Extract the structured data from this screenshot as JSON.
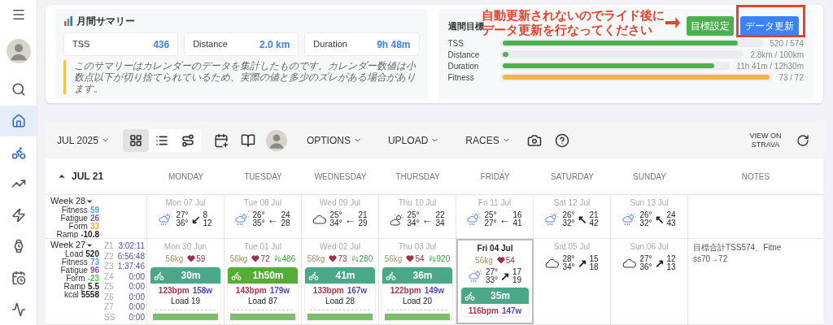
{
  "sidebar": {
    "items": [
      {
        "selected": false,
        "active": false
      },
      {
        "selected": false,
        "active": false
      },
      {
        "selected": true,
        "active": true
      },
      {
        "selected": false,
        "active": true
      },
      {
        "selected": false,
        "active": false
      },
      {
        "selected": false,
        "active": false
      },
      {
        "selected": false,
        "active": false
      },
      {
        "selected": false,
        "active": false
      },
      {
        "selected": false,
        "active": false
      }
    ]
  },
  "summary": {
    "title": "月間サマリー",
    "stats": [
      {
        "label": "TSS",
        "value": "436"
      },
      {
        "label": "Distance",
        "value": "2.0 km"
      },
      {
        "label": "Duration",
        "value": "9h 48m"
      }
    ],
    "note": "このサマリーはカレンダーのデータを集計したものです。カレンダー数値は小数点以下が切り捨てられているため、実際の値と多少のズレがある場合があります。"
  },
  "goals": {
    "title": "週間目標",
    "buttons": [
      {
        "label": "目標設定",
        "kind": "secondary"
      },
      {
        "label": "データ更新",
        "kind": "primary"
      }
    ],
    "rows": [
      {
        "label": "TSS",
        "level": 0.91,
        "reading": "520 / 574",
        "color": "#4caf50"
      },
      {
        "label": "Distance",
        "level": 0.02,
        "reading": "2.8km / 100km",
        "color": "#4caf50"
      },
      {
        "label": "Duration",
        "level": 0.94,
        "reading": "11h 41m / 12h30m",
        "color": "#4caf50"
      },
      {
        "label": "Fitness",
        "level": 1,
        "reading": "73 / 72",
        "color": "#f4b63c"
      }
    ]
  },
  "annotation": {
    "lines": [
      "自動更新されないのでライド後に",
      "データ更新を行なってください"
    ]
  },
  "toolbar": {
    "month": "JUL 2025",
    "view_modes": [
      {
        "selected": true
      },
      {
        "selected": false
      },
      {
        "selected": false
      }
    ],
    "menus": [
      "OPTIONS",
      "UPLOAD",
      "RACES"
    ],
    "strava": "VIEW ON STRAVA"
  },
  "calendar": {
    "week_label": "JUL 21",
    "days": [
      "MONDAY",
      "TUESDAY",
      "WEDNESDAY",
      "THURSDAY",
      "FRIDAY",
      "SATURDAY",
      "SUNDAY"
    ],
    "notes_heading": "NOTES",
    "weeks": [
      {
        "label": "Week 28",
        "stats": [
          {
            "label": "Fitness",
            "value": "59",
            "color": "#4fa3e0"
          },
          {
            "label": "Fatigue",
            "value": "26",
            "color": "#7e57c2"
          },
          {
            "label": "Form",
            "value": "33",
            "color": "#f0b429"
          },
          {
            "label": "Ramp",
            "value": "-10.8",
            "color": "#222222"
          }
        ],
        "days": [
          {
            "date": "Mon 07 Jul",
            "today": false,
            "weather": {
              "kind": "rain",
              "temps": [
                "27°",
                "36°"
              ],
              "arrow": "↙",
              "wind": [
                "8",
                "12"
              ]
            }
          },
          {
            "date": "Tue 08 Jul",
            "today": false,
            "weather": {
              "kind": "rain",
              "temps": [
                "26°",
                "35°"
              ],
              "arrow": "←",
              "wind": [
                "24",
                "28"
              ]
            }
          },
          {
            "date": "Wed 09 Jul",
            "today": false,
            "weather": {
              "kind": "cloud",
              "temps": [
                "25°",
                "34°"
              ],
              "arrow": "←",
              "wind": [
                "21",
                "29"
              ]
            }
          },
          {
            "date": "Thu 10 Jul",
            "today": false,
            "weather": {
              "kind": "partly_cloudy",
              "temps": [
                "25°",
                "34°"
              ],
              "arrow": "←",
              "wind": [
                "22",
                "34"
              ]
            }
          },
          {
            "date": "Fri 11 Jul",
            "today": false,
            "weather": {
              "kind": "rain",
              "temps": [
                "25°",
                "27°"
              ],
              "arrow": "←",
              "wind": [
                "16",
                "41"
              ]
            }
          },
          {
            "date": "Sat 12 Jul",
            "today": false,
            "weather": {
              "kind": "rain",
              "temps": [
                "26°",
                "32°"
              ],
              "arrow": "↖",
              "wind": [
                "21",
                "42"
              ]
            }
          },
          {
            "date": "Sun 13 Jul",
            "today": false,
            "weather": {
              "kind": "rain",
              "temps": [
                "26°",
                "32°"
              ],
              "arrow": "↖",
              "wind": [
                "24",
                "43"
              ]
            }
          }
        ]
      },
      {
        "label": "Week 27",
        "stats": [
          {
            "label": "Load",
            "value": "520",
            "color": "#222222"
          },
          {
            "label": "Fitness",
            "value": "73",
            "color": "#4fa3e0"
          },
          {
            "label": "Fatigue",
            "value": "96",
            "color": "#7e57c2"
          },
          {
            "label": "Form",
            "value": "-23",
            "color": "#5cb85c"
          },
          {
            "label": "Ramp",
            "value": "5.5",
            "color": "#222222"
          },
          {
            "label": "kcal",
            "value": "5558",
            "color": "#222222"
          }
        ],
        "zones": [
          {
            "label": "Z1",
            "value": "3:02:11"
          },
          {
            "label": "Z2",
            "value": "6:56:48"
          },
          {
            "label": "Z3",
            "value": "1:37:46"
          },
          {
            "label": "Z4",
            "value": "0:00"
          },
          {
            "label": "Z5",
            "value": "0:00"
          },
          {
            "label": "Z6",
            "value": "0:00"
          },
          {
            "label": "Z7",
            "value": "0:00"
          },
          {
            "label": "SS",
            "value": "0:00"
          }
        ],
        "note": "目標合計TSS574、Fitness70→72",
        "days": [
          {
            "date": "Mon 30 Jun",
            "today": false,
            "metrics": {
              "weight": "56kg",
              "heart": "59"
            },
            "activity": {
              "duration": "30m",
              "color": "#4aa889",
              "hr": "123bpm",
              "power": "158w",
              "load": "Load 19"
            }
          },
          {
            "date": "Tue 01 Jul",
            "today": false,
            "metrics": {
              "weight": "56kg",
              "heart": "72",
              "steps": "486"
            },
            "activity": {
              "duration": "1h50m",
              "color": "#55ad35",
              "hr": "143bpm",
              "power": "179w",
              "load": "Load 87"
            }
          },
          {
            "date": "Wed 02 Jul",
            "today": false,
            "metrics": {
              "weight": "56kg",
              "heart": "73",
              "steps": "280"
            },
            "activity": {
              "duration": "41m",
              "color": "#4aa889",
              "hr": "133bpm",
              "power": "167w",
              "load": "Load 28"
            }
          },
          {
            "date": "Thu 03 Jul",
            "today": false,
            "metrics": {
              "weight": "56kg",
              "heart": "54",
              "steps": "920"
            },
            "activity": {
              "duration": "36m",
              "color": "#4aa889",
              "hr": "122bpm",
              "power": "149w",
              "load": "Load 20"
            }
          },
          {
            "date": "Fri 04 Jul",
            "today": true,
            "metrics": {
              "weight": "56kg",
              "heart": "54"
            },
            "weather": {
              "kind": "rain",
              "temps": [
                "27°",
                "33°"
              ],
              "arrow": "↗",
              "wind": [
                "17",
                "19"
              ]
            },
            "activity": {
              "duration": "35m",
              "color": "#4aa889",
              "hr": "116bpm",
              "power": "147w"
            }
          },
          {
            "date": "Sat 05 Jul",
            "today": false,
            "weather": {
              "kind": "cloud",
              "temps": [
                "28°",
                "34°"
              ],
              "arrow": "↗",
              "wind": [
                "15",
                "18"
              ]
            }
          },
          {
            "date": "Sun 06 Jul",
            "today": false,
            "weather": {
              "kind": "cloud",
              "temps": [
                "27°",
                "36°"
              ],
              "arrow": "↗",
              "wind": [
                "12",
                "13"
              ]
            }
          }
        ]
      }
    ]
  }
}
